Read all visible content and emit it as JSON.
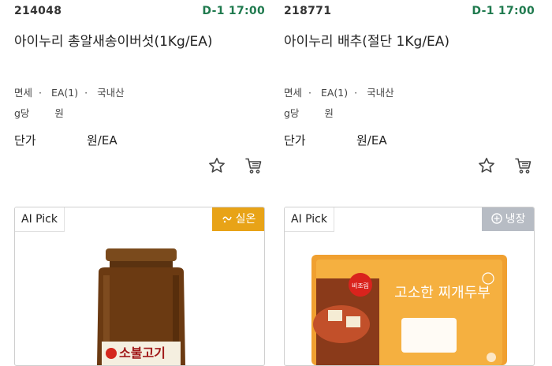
{
  "products": [
    {
      "id": "214048",
      "deadline": "D-1 17:00",
      "name": "아이누리 총알새송이버섯(1Kg/EA)",
      "meta": {
        "tax": "면세",
        "sep1": "·",
        "qty": "EA(1)",
        "sep2": "·",
        "origin": "국내산"
      },
      "gram": {
        "unit": "g당",
        "won": "원"
      },
      "unit_price": {
        "label": "단가",
        "value": "원/EA"
      },
      "ai_badge": "AI Pick",
      "storage": "실온",
      "storage_color": "#e8a317",
      "icons": [
        "star-icon",
        "cart-icon"
      ]
    },
    {
      "id": "218771",
      "deadline": "D-1 17:00",
      "name": "아이누리 배추(절단 1Kg/EA)",
      "meta": {
        "tax": "면세",
        "sep1": "·",
        "qty": "EA(1)",
        "sep2": "·",
        "origin": "국내산"
      },
      "gram": {
        "unit": "g당",
        "won": "원"
      },
      "unit_price": {
        "label": "단가",
        "value": "원/EA"
      },
      "ai_badge": "AI Pick",
      "storage": "냉장",
      "storage_color": "#b7bcc4",
      "icons": [
        "star-icon",
        "cart-icon"
      ],
      "package_text": "고소한 찌개두부",
      "package_sticker": "비조림"
    }
  ]
}
